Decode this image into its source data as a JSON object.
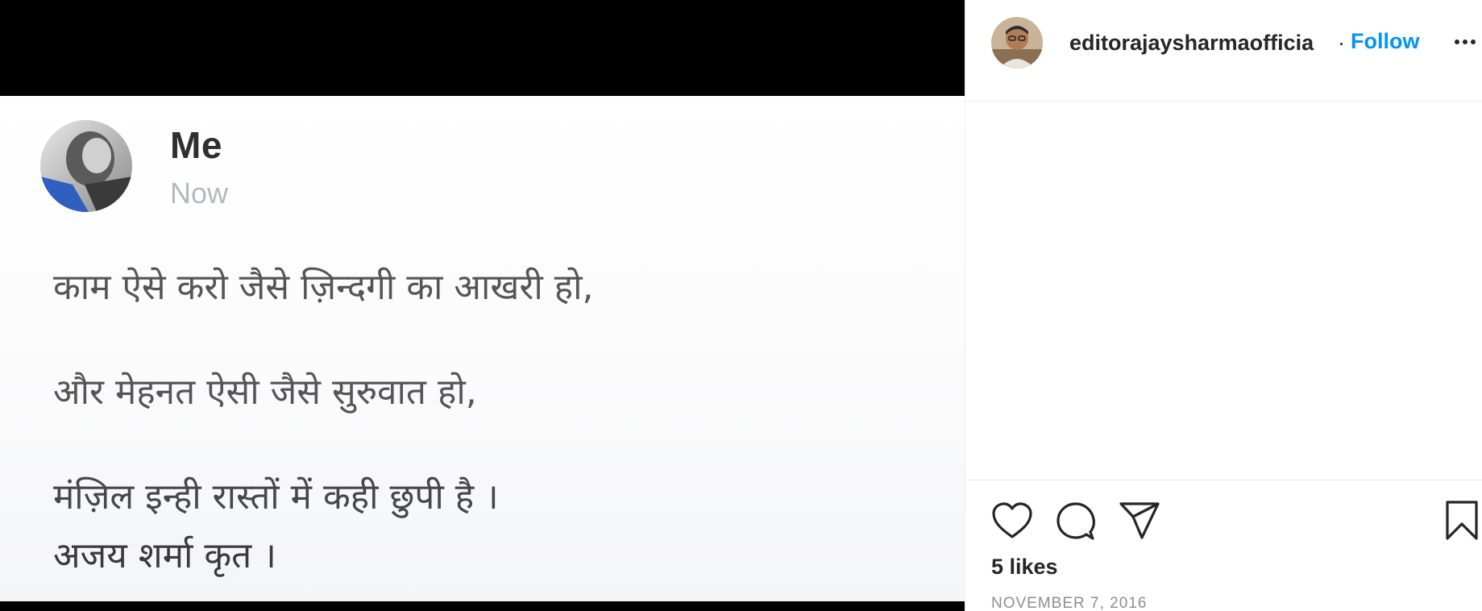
{
  "post": {
    "author_name": "Me",
    "time": "Now",
    "lines": [
      "काम ऐसे करो जैसे ज़िन्दगी का आखरी हो,",
      "और मेहनत ऐसी जैसे सुरुवात हो,",
      "मंज़िल इन्ही रास्तों में कही छुपी है ।",
      "अजय शर्मा कृत ।"
    ]
  },
  "header": {
    "username": "editorajaysharmaofficia",
    "separator": "·",
    "follow_label": "Follow",
    "more_icon": "more-horizontal-icon"
  },
  "actions": {
    "like_icon": "heart-icon",
    "comment_icon": "comment-icon",
    "share_icon": "paper-plane-icon",
    "save_icon": "bookmark-icon",
    "likes_text": "5 likes",
    "date_text": "NOVEMBER 7, 2016"
  },
  "colors": {
    "accent": "#0095f6",
    "text": "#262626",
    "muted": "#8e8e8e",
    "media_bg": "#000000"
  }
}
